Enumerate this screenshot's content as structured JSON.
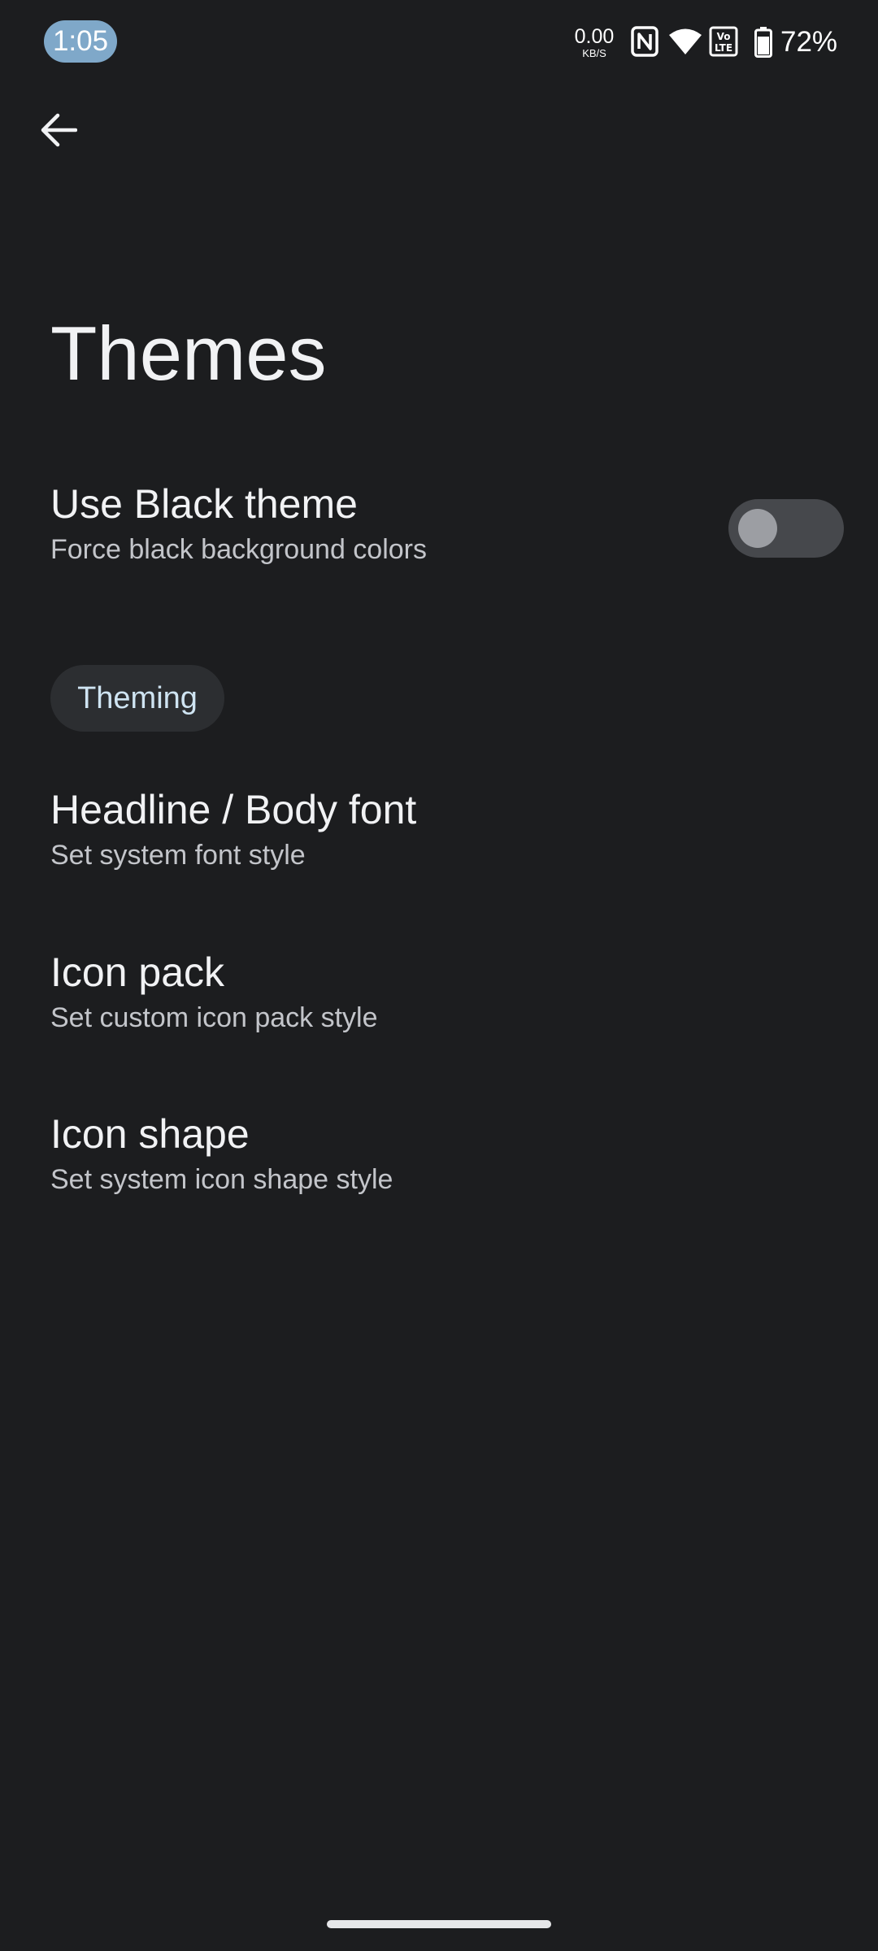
{
  "status_bar": {
    "time": "1:05",
    "net_speed_value": "0.00",
    "net_speed_unit": "KB/S",
    "icons": [
      "nfc-icon",
      "wifi-icon",
      "volte-icon",
      "battery-icon"
    ],
    "battery_percent": "72%"
  },
  "header": {
    "back_icon": "arrow-left-icon",
    "title": "Themes"
  },
  "settings": {
    "black_theme": {
      "title": "Use Black theme",
      "subtitle": "Force black background colors",
      "enabled": false
    },
    "section_label": "Theming",
    "items": [
      {
        "title": "Headline / Body font",
        "subtitle": "Set system font style"
      },
      {
        "title": "Icon pack",
        "subtitle": "Set custom icon pack style"
      },
      {
        "title": "Icon shape",
        "subtitle": "Set system icon shape style"
      }
    ]
  },
  "colors": {
    "background": "#1c1d1f",
    "accent_time_pill": "#7fa8c9",
    "chip_text": "#cfe4f2"
  }
}
